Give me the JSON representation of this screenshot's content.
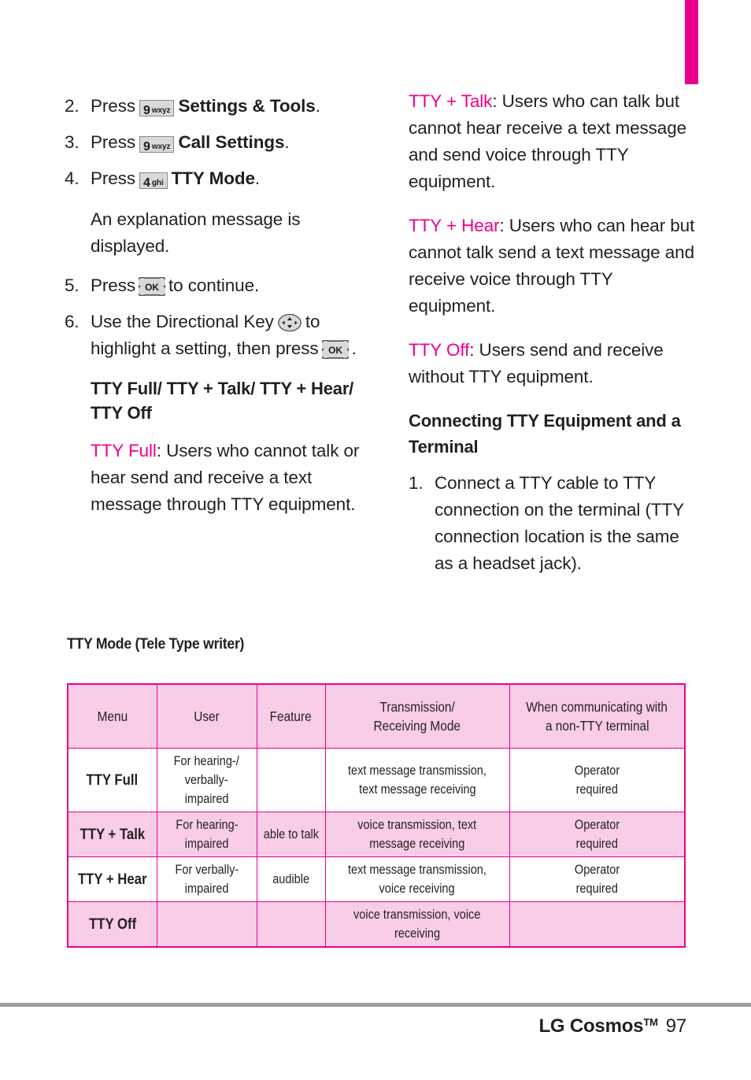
{
  "page": {
    "tab_color": "#ec008c",
    "accent_color": "#ec008c",
    "header_fill": "#f9cce7"
  },
  "left_column": {
    "steps": [
      {
        "num": "2.",
        "lead": "Press",
        "key": {
          "digit": "9",
          "letters": "wxyz"
        },
        "bold_text": "Settings & Tools",
        "tail": "."
      },
      {
        "num": "3.",
        "lead": "Press",
        "key": {
          "digit": "9",
          "letters": "wxyz"
        },
        "bold_text": "Call Settings",
        "tail": "."
      },
      {
        "num": "4.",
        "lead": "Press",
        "key": {
          "digit": "4",
          "letters": "ghi"
        },
        "bold_text": "TTY Mode",
        "tail": "."
      }
    ],
    "note": "An explanation message is displayed.",
    "step5": {
      "num": "5.",
      "lead": "Press",
      "key_icon": "ok-key-icon",
      "tail": "to continue."
    },
    "step6": {
      "num": "6.",
      "lead": "Use the Directional Key",
      "dir_icon": "directional-key-icon",
      "mid": "to highlight a setting, then press",
      "ok_icon": "ok-key-icon",
      "tail": "."
    },
    "subhead": "TTY Full/ TTY + Talk/ TTY + Hear/ TTY Off",
    "tty_full": {
      "label": "TTY Full",
      "body": ": Users who cannot  talk or hear send and receive a text message through TTY equipment."
    }
  },
  "right_column": {
    "tty_talk": {
      "label": "TTY + Talk",
      "body": ": Users who can talk but cannot hear receive a text message and send voice through TTY equipment."
    },
    "tty_hear": {
      "label": "TTY + Hear",
      "body": ": Users who can hear but cannot talk send a text message and receive voice through TTY equipment."
    },
    "tty_off": {
      "label": "TTY Off",
      "body": ": Users send and receive without TTY equipment."
    },
    "section_heading": "Connecting TTY Equipment and a Terminal",
    "step1": {
      "num": "1.",
      "text": "Connect a TTY cable to TTY connection on the terminal (TTY connection location is the same as a headset jack)."
    }
  },
  "table": {
    "caption": "TTY Mode (Tele Type writer)",
    "headers": [
      "Menu",
      "User",
      "Feature",
      "Transmission/\nReceiving Mode",
      "When communicating with\na non-TTY terminal"
    ],
    "header_mode_line1": "Transmission/",
    "header_mode_line2": "Receiving Mode",
    "header_when_line1": "When communicating with",
    "header_when_line2": "a non-TTY terminal",
    "rows": [
      {
        "menu": "TTY Full",
        "user_line1": "For hearing-/",
        "user_line2": "verbally-",
        "user_line3": "impaired",
        "feature": "",
        "mode_line1": "text message transmission,",
        "mode_line2": "text message receiving",
        "when_line1": "Operator",
        "when_line2": "required",
        "shaded": false
      },
      {
        "menu": "TTY + Talk",
        "user_line1": "For hearing-",
        "user_line2": "impaired",
        "user_line3": "",
        "feature": "able to talk",
        "mode_line1": "voice transmission, text",
        "mode_line2": "message receiving",
        "when_line1": "Operator",
        "when_line2": "required",
        "shaded": true
      },
      {
        "menu": "TTY + Hear",
        "user_line1": "For verbally-",
        "user_line2": "impaired",
        "user_line3": "",
        "feature": "audible",
        "mode_line1": "text message transmission,",
        "mode_line2": "voice receiving",
        "when_line1": "Operator",
        "when_line2": "required",
        "shaded": false
      },
      {
        "menu": "TTY Off",
        "user_line1": "",
        "user_line2": "",
        "user_line3": "",
        "feature": "",
        "mode_line1": "voice transmission, voice",
        "mode_line2": "receiving",
        "when_line1": "",
        "when_line2": "",
        "shaded": true
      }
    ]
  },
  "footer": {
    "brand": "LG Cosmos",
    "trademark": "TM",
    "page_number": "97"
  }
}
